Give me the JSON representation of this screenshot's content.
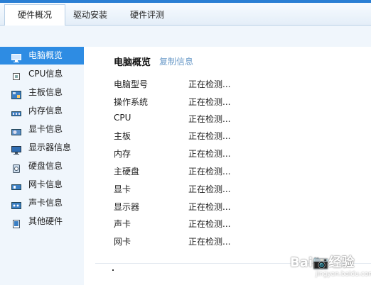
{
  "tabs": [
    {
      "label": "硬件概况",
      "active": true
    },
    {
      "label": "驱动安装",
      "active": false
    },
    {
      "label": "硬件评测",
      "active": false
    }
  ],
  "sidebar": {
    "items": [
      {
        "label": "电脑概览",
        "icon": "computer-overview-icon",
        "active": true
      },
      {
        "label": "CPU信息",
        "icon": "cpu-icon",
        "active": false
      },
      {
        "label": "主板信息",
        "icon": "motherboard-icon",
        "active": false
      },
      {
        "label": "内存信息",
        "icon": "memory-icon",
        "active": false
      },
      {
        "label": "显卡信息",
        "icon": "graphics-card-icon",
        "active": false
      },
      {
        "label": "显示器信息",
        "icon": "monitor-icon",
        "active": false
      },
      {
        "label": "硬盘信息",
        "icon": "hard-disk-icon",
        "active": false
      },
      {
        "label": "网卡信息",
        "icon": "network-card-icon",
        "active": false
      },
      {
        "label": "声卡信息",
        "icon": "sound-card-icon",
        "active": false
      },
      {
        "label": "其他硬件",
        "icon": "other-hardware-icon",
        "active": false
      }
    ]
  },
  "main": {
    "title": "电脑概览",
    "copy_label": "复制信息",
    "rows": [
      {
        "label": "电脑型号",
        "value": "正在检测..."
      },
      {
        "label": "操作系统",
        "value": "正在检测..."
      },
      {
        "label": "CPU",
        "value": "正在检测..."
      },
      {
        "label": "主板",
        "value": "正在检测..."
      },
      {
        "label": "内存",
        "value": "正在检测..."
      },
      {
        "label": "主硬盘",
        "value": "正在检测..."
      },
      {
        "label": "显卡",
        "value": "正在检测..."
      },
      {
        "label": "显示器",
        "value": "正在检测..."
      },
      {
        "label": "声卡",
        "value": "正在检测..."
      },
      {
        "label": "网卡",
        "value": "正在检测..."
      }
    ]
  },
  "watermark": {
    "text": "Bai📷经验",
    "sub": "jingyan.baidu.com"
  },
  "colors": {
    "accent": "#2e8ce3",
    "link": "#6a9ac8",
    "sidebar_bg": "#f0f6fc"
  }
}
